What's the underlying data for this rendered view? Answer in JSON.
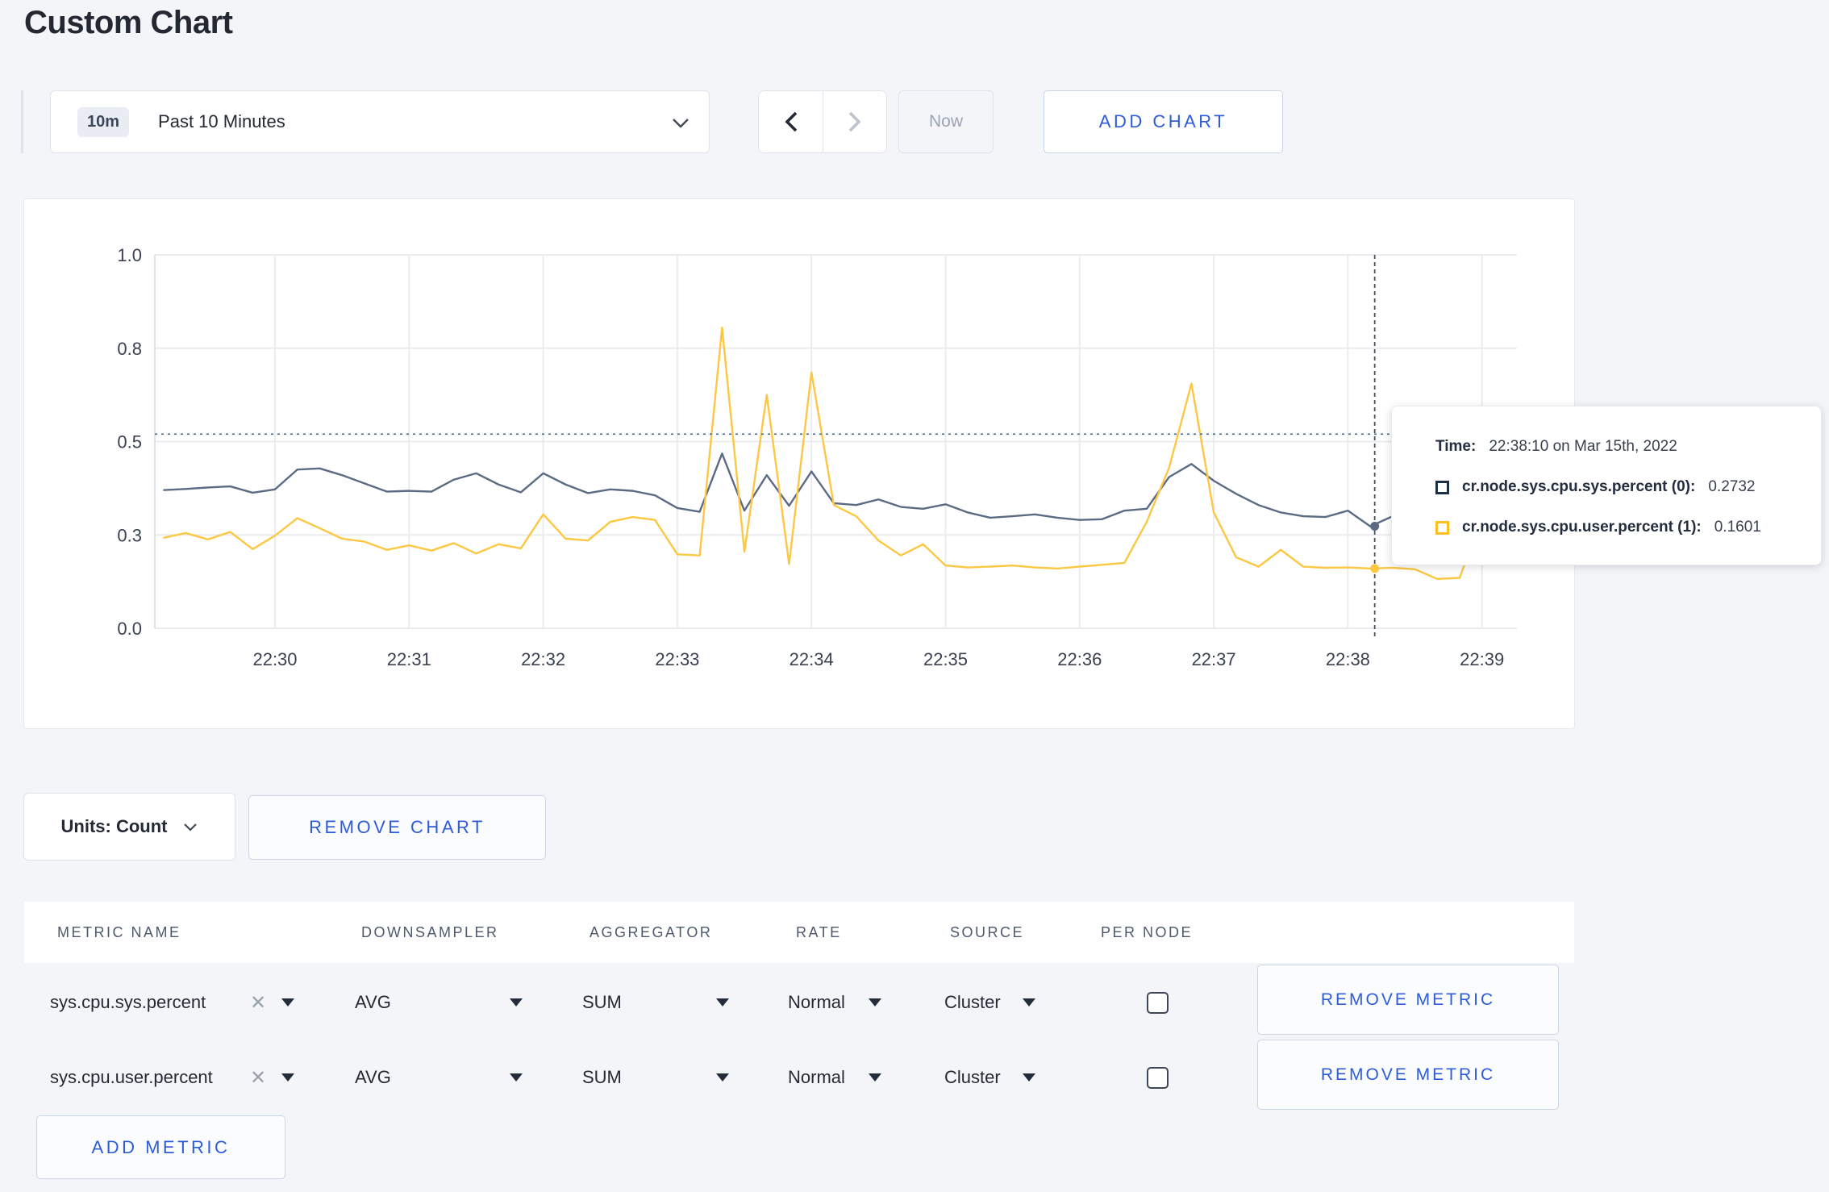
{
  "page": {
    "title": "Custom Chart"
  },
  "toolbar": {
    "time_badge": "10m",
    "time_label": "Past 10 Minutes",
    "now_label": "Now",
    "add_chart_label": "ADD CHART"
  },
  "chart_actions": {
    "units_label": "Units: Count",
    "remove_chart_label": "REMOVE CHART"
  },
  "chart_data": {
    "type": "line",
    "x_ticks": [
      "22:30",
      "22:31",
      "22:32",
      "22:33",
      "22:34",
      "22:35",
      "22:36",
      "22:37",
      "22:38",
      "22:39"
    ],
    "y_ticks": {
      "values": [
        0,
        0.25,
        0.5,
        0.75,
        1.0
      ],
      "labels": [
        "0.0",
        "0.3",
        "0.5",
        "0.8",
        "1.0"
      ]
    },
    "ylim": [
      0,
      1
    ],
    "x_start_min": -0.8333,
    "x_step_min": 0.16667,
    "series": [
      {
        "name": "cr.node.sys.cpu.sys.percent",
        "color": "#5b6b84",
        "values": [
          0.37,
          0.373,
          0.377,
          0.38,
          0.363,
          0.372,
          0.425,
          0.428,
          0.41,
          0.388,
          0.366,
          0.368,
          0.366,
          0.398,
          0.415,
          0.385,
          0.364,
          0.415,
          0.385,
          0.362,
          0.372,
          0.368,
          0.356,
          0.322,
          0.312,
          0.468,
          0.315,
          0.41,
          0.328,
          0.42,
          0.335,
          0.33,
          0.345,
          0.325,
          0.32,
          0.332,
          0.31,
          0.296,
          0.3,
          0.305,
          0.296,
          0.29,
          0.292,
          0.315,
          0.32,
          0.405,
          0.44,
          0.395,
          0.36,
          0.33,
          0.31,
          0.3,
          0.298,
          0.315,
          0.273,
          0.3,
          0.308,
          0.31,
          0.3,
          0.296,
          0.305
        ]
      },
      {
        "name": "cr.node.sys.cpu.user.percent",
        "color": "#fcc843",
        "values": [
          0.242,
          0.255,
          0.238,
          0.258,
          0.212,
          0.248,
          0.295,
          0.268,
          0.24,
          0.232,
          0.21,
          0.222,
          0.208,
          0.228,
          0.2,
          0.225,
          0.214,
          0.305,
          0.24,
          0.235,
          0.285,
          0.298,
          0.29,
          0.198,
          0.195,
          0.805,
          0.205,
          0.625,
          0.172,
          0.685,
          0.33,
          0.3,
          0.235,
          0.195,
          0.225,
          0.168,
          0.163,
          0.165,
          0.168,
          0.163,
          0.16,
          0.165,
          0.17,
          0.175,
          0.285,
          0.43,
          0.655,
          0.31,
          0.19,
          0.165,
          0.21,
          0.165,
          0.162,
          0.163,
          0.16,
          0.162,
          0.158,
          0.132,
          0.135,
          0.3,
          0.262
        ]
      }
    ],
    "crosshair": {
      "time_min": 8.2,
      "value_line": 0.52,
      "points": [
        {
          "series": 0,
          "value": 0.2732
        },
        {
          "series": 1,
          "value": 0.1601
        }
      ]
    },
    "grid": true,
    "legend_position": "tooltip"
  },
  "tooltip": {
    "time_label": "Time:",
    "time_value": "22:38:10 on Mar 15th, 2022",
    "series": [
      {
        "label": "cr.node.sys.cpu.sys.percent (0):",
        "value": "0.2732",
        "color": "#1c2f45"
      },
      {
        "label": "cr.node.sys.cpu.user.percent (1):",
        "value": "0.1601",
        "color": "#fcc020"
      }
    ]
  },
  "metrics_table": {
    "headers": [
      "METRIC NAME",
      "DOWNSAMPLER",
      "AGGREGATOR",
      "RATE",
      "SOURCE",
      "PER NODE"
    ],
    "rows": [
      {
        "metric": "sys.cpu.sys.percent",
        "clear": "✕",
        "downsampler": "AVG",
        "aggregator": "SUM",
        "rate": "Normal",
        "source": "Cluster",
        "per_node_checked": false,
        "remove_label": "REMOVE METRIC"
      },
      {
        "metric": "sys.cpu.user.percent",
        "clear": "✕",
        "downsampler": "AVG",
        "aggregator": "SUM",
        "rate": "Normal",
        "source": "Cluster",
        "per_node_checked": false,
        "remove_label": "REMOVE METRIC"
      }
    ],
    "add_metric_label": "ADD METRIC"
  }
}
